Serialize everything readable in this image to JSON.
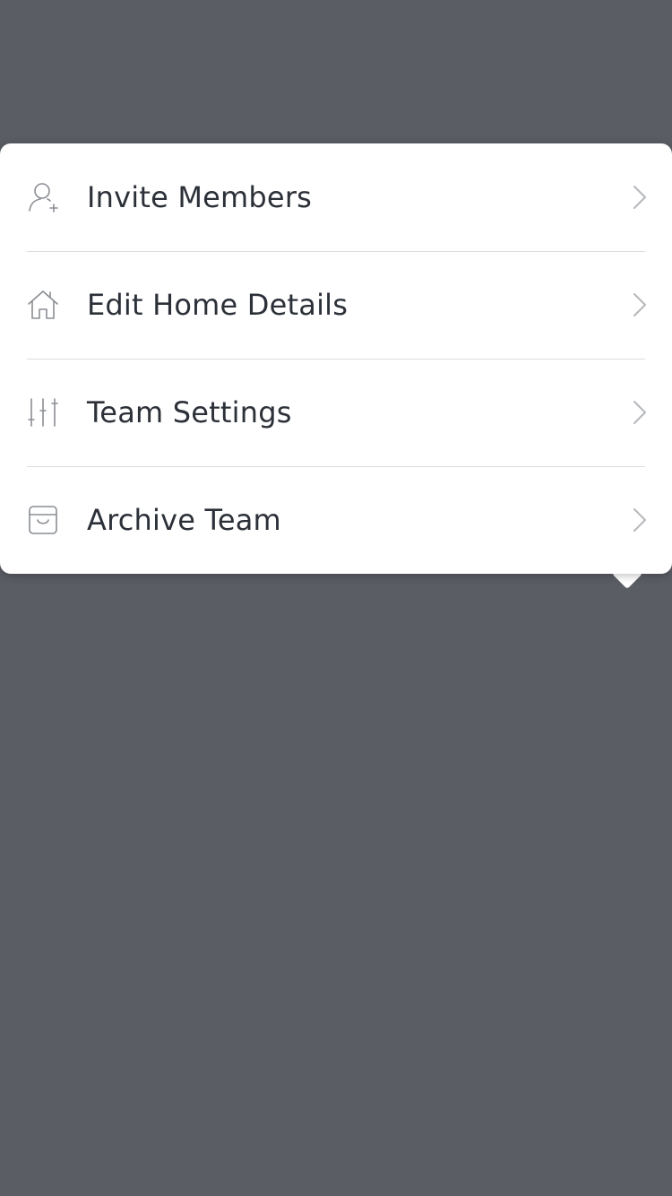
{
  "colors": {
    "backdrop": "#5a5d64",
    "menu_bg": "#ffffff",
    "text": "#2c3038",
    "icon": "#8a8d93",
    "divider": "#dcdcdc",
    "chevron": "#b5b7bb"
  },
  "menu": {
    "items": [
      {
        "label": "Invite Members",
        "icon": "add-user-icon"
      },
      {
        "label": "Edit Home Details",
        "icon": "home-icon"
      },
      {
        "label": "Team Settings",
        "icon": "sliders-icon"
      },
      {
        "label": "Archive Team",
        "icon": "archive-icon"
      }
    ]
  }
}
